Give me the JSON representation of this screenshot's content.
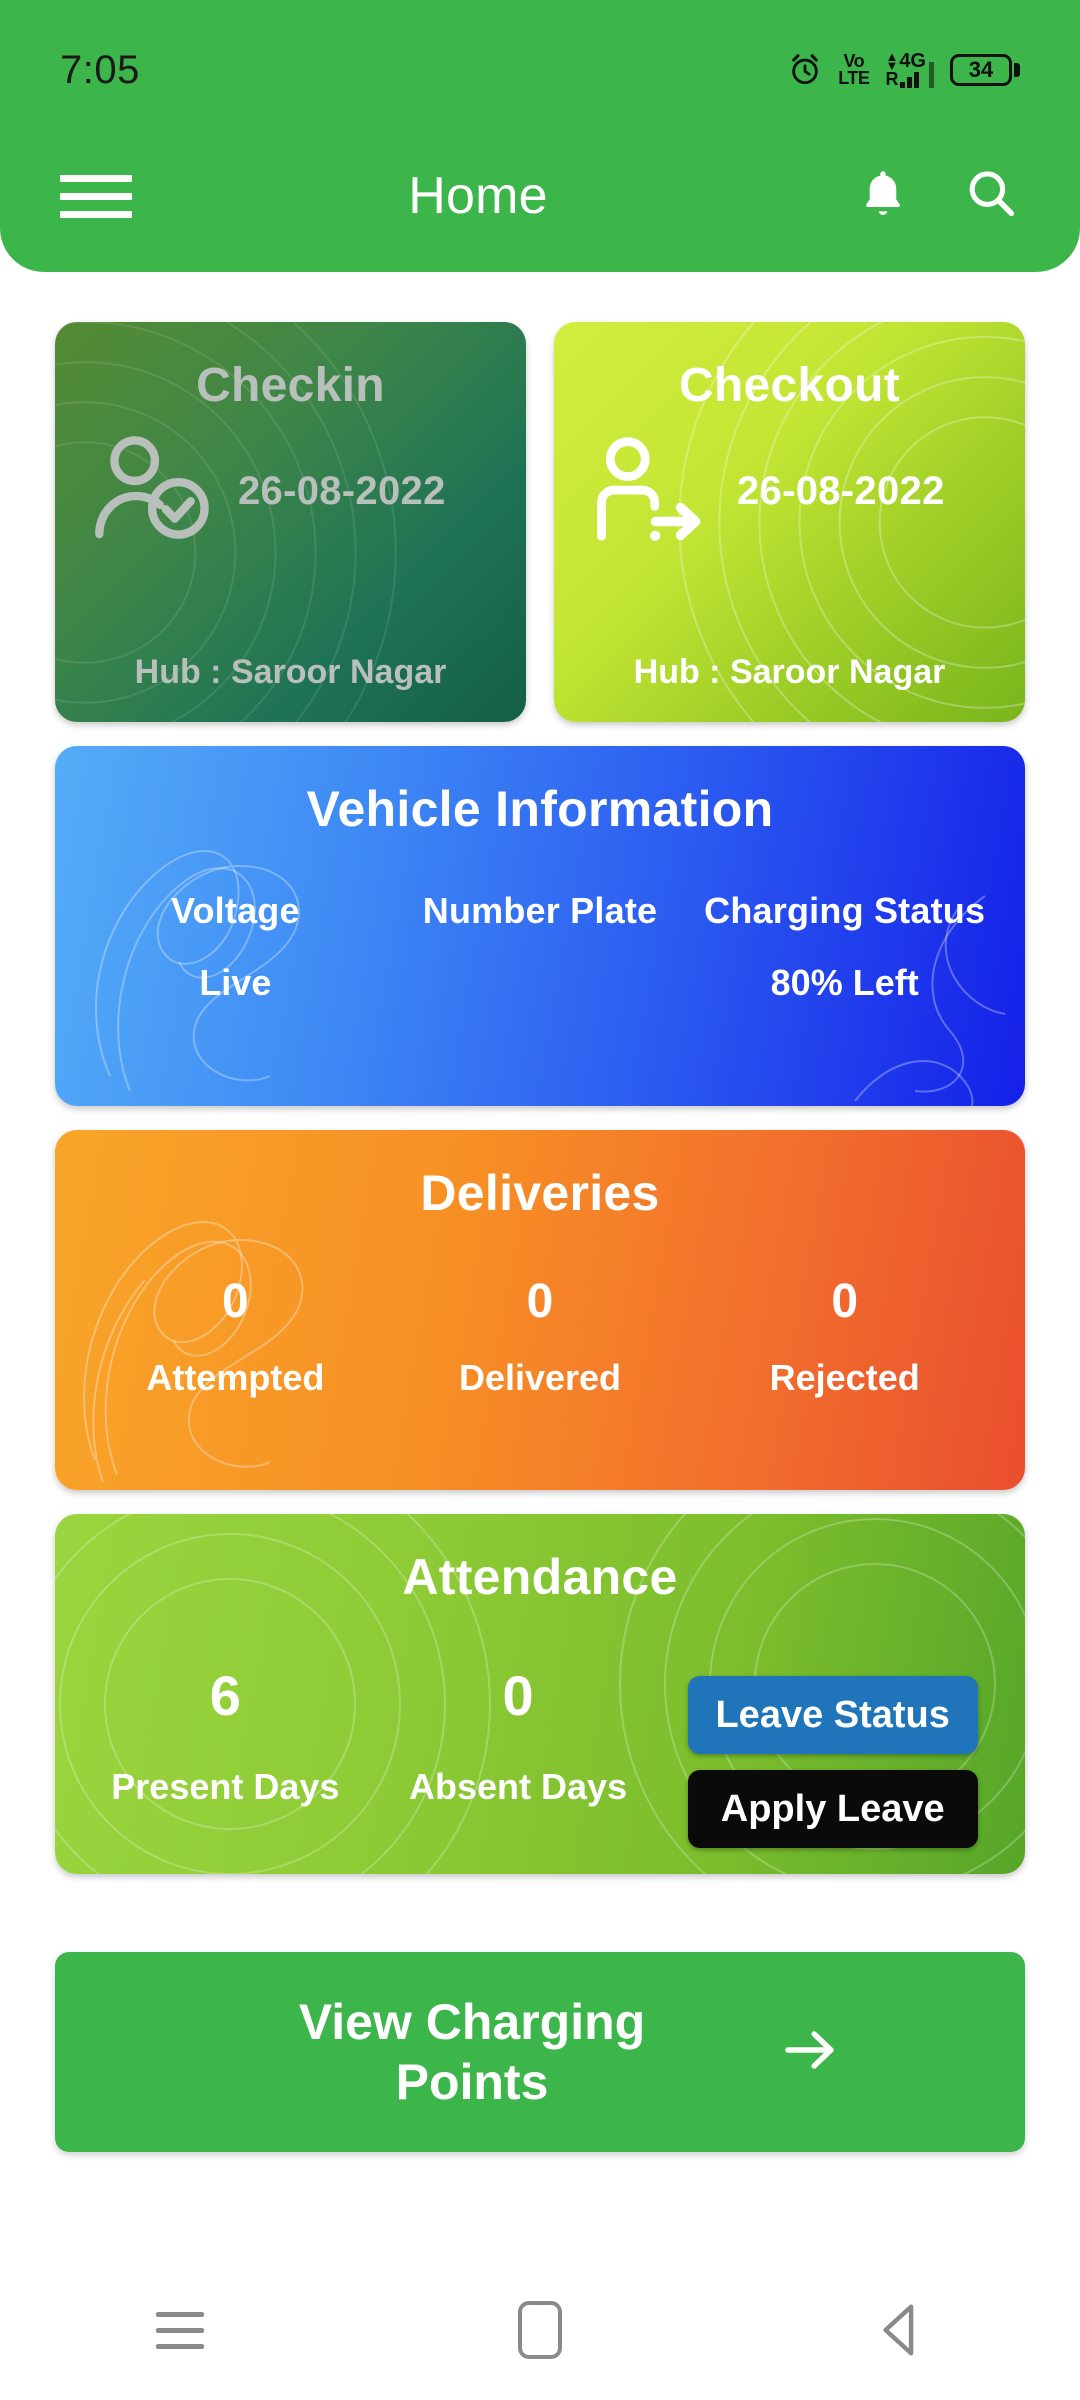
{
  "status_bar": {
    "time": "7:05",
    "alarm_icon": "alarm-clock-icon",
    "volte_line1": "Vo",
    "volte_line2": "LTE",
    "network_type": "4G",
    "roaming": "R",
    "battery_level": "34"
  },
  "app_bar": {
    "menu_icon": "hamburger-menu-icon",
    "title": "Home",
    "notification_icon": "bell-icon",
    "search_icon": "search-icon",
    "background_color": "#3cb54a"
  },
  "checkin_card": {
    "title": "Checkin",
    "icon": "person-check-icon",
    "date": "26-08-2022",
    "hub": "Hub : Saroor Nagar",
    "state": "disabled"
  },
  "checkout_card": {
    "title": "Checkout",
    "icon": "person-exit-arrow-icon",
    "date": "26-08-2022",
    "hub": "Hub : Saroor Nagar",
    "state": "enabled"
  },
  "vehicle_card": {
    "title": "Vehicle Information",
    "columns": [
      {
        "header": "Voltage",
        "value": "Live"
      },
      {
        "header": "Number Plate",
        "value": ""
      },
      {
        "header": "Charging Status",
        "value": "80% Left"
      }
    ],
    "accent_color": "#2a58f0"
  },
  "deliveries_card": {
    "title": "Deliveries",
    "stats": [
      {
        "count": "0",
        "label": "Attempted"
      },
      {
        "count": "0",
        "label": "Delivered"
      },
      {
        "count": "0",
        "label": "Rejected"
      }
    ],
    "accent_color": "#f2712d"
  },
  "attendance_card": {
    "title": "Attendance",
    "stats": [
      {
        "count": "6",
        "label": "Present Days"
      },
      {
        "count": "0",
        "label": "Absent Days"
      }
    ],
    "leave_status_button": "Leave Status",
    "apply_leave_button": "Apply Leave",
    "leave_status_color": "#1f74ba",
    "apply_leave_color": "#0a0a0a",
    "accent_color": "#7bbd2c"
  },
  "charging_button": {
    "label": "View Charging Points",
    "arrow_icon": "arrow-right-icon",
    "background_color": "#3cb54a"
  },
  "nav_bar": {
    "recents_icon": "recents-icon",
    "home_icon": "home-square-icon",
    "back_icon": "back-triangle-icon"
  }
}
